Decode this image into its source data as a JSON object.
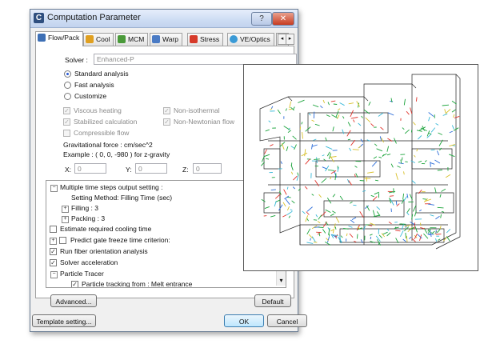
{
  "window": {
    "title": "Computation Parameter",
    "help_label": "?",
    "close_label": "✕",
    "app_glyph": "C"
  },
  "tabs": [
    {
      "label": "Flow/Pack",
      "color": "#3d6fb5"
    },
    {
      "label": "Cool",
      "color": "#e0a020"
    },
    {
      "label": "MCM",
      "color": "#4a9a3a"
    },
    {
      "label": "Warp",
      "color": "#4a7bc5"
    },
    {
      "label": "Stress",
      "color": "#d63a2a"
    },
    {
      "label": "VE/Optics",
      "color": "#3a9ad6"
    },
    {
      "label": "",
      "color": "#555555"
    }
  ],
  "tab_scroll": {
    "left": "◂",
    "right": "▸"
  },
  "solver": {
    "label": "Solver :",
    "value": "Enhanced-P"
  },
  "analysis": [
    "Standard analysis",
    "Fast analysis",
    "Customize"
  ],
  "options": {
    "viscous": "Viscous heating",
    "nonisothermal": "Non-isothermal",
    "stabilized": "Stabilized calculation",
    "nonnewtonian": "Non-Newtonian flow",
    "compressible": "Compressible flow",
    "check_mark": "✓"
  },
  "gravity": {
    "title": "Gravitational force :  cm/sec^2",
    "example": "Example : ( 0, 0, -980 ) for z-gravity",
    "x_label": "X:",
    "y_label": "Y:",
    "z_label": "Z:",
    "x": "0",
    "y": "0",
    "z": "0"
  },
  "tree": {
    "multi": "Multiple time steps output setting :",
    "method": "Setting Method: Filling Time (sec)",
    "filling": "Filling :  3",
    "packing": "Packing :  3",
    "cooling": "Estimate required cooling time",
    "gate": "Predict gate freeze time criterion:",
    "fiber": "Run fiber orientation analysis",
    "solver_acc": "Solver acceleration",
    "particle": "Particle Tracer",
    "particle_sub": "Particle tracking from : Melt entrance",
    "minus": "−",
    "plus": "+",
    "scroll_down": "▾"
  },
  "buttons": {
    "advanced": "Advanced...",
    "default": "Default",
    "template": "Template setting...",
    "ok": "OK",
    "cancel": "Cancel"
  }
}
